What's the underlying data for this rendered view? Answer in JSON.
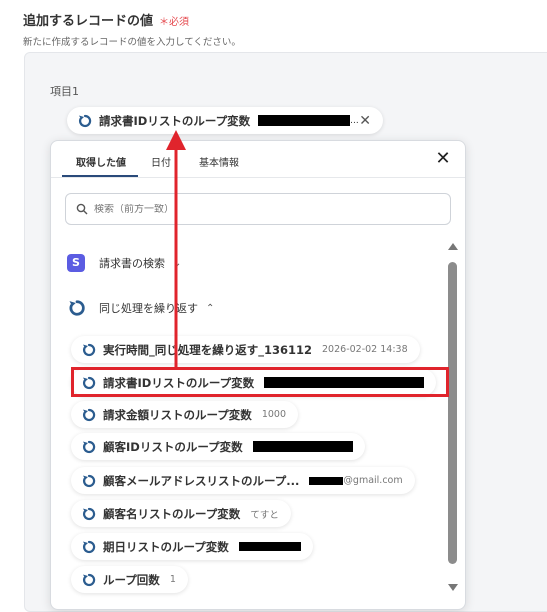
{
  "header": {
    "title": "追加するレコードの値",
    "required": "必須",
    "subtitle": "新たに作成するレコードの値を入力してください。"
  },
  "field": {
    "label": "項目1",
    "selected_chip": "請求書IDリストのループ変数",
    "selected_suffix": "..."
  },
  "dropdown": {
    "tabs": [
      "取得した値",
      "日付",
      "基本情報"
    ],
    "search_placeholder": "検索（前方一致）",
    "groups": [
      {
        "label": "請求書の検索",
        "badge": "S"
      },
      {
        "label": "同じ処理を繰り返す"
      }
    ],
    "items": [
      {
        "label": "実行時間_同じ処理を繰り返す_136112",
        "value": "2026-02-02 14:38"
      },
      {
        "label": "請求書IDリストのループ変数",
        "value": ""
      },
      {
        "label": "請求金額リストのループ変数",
        "value": "1000"
      },
      {
        "label": "顧客IDリストのループ変数",
        "value": ""
      },
      {
        "label": "顧客メールアドレスリストのループ...",
        "value": "@gmail.com"
      },
      {
        "label": "顧客名リストのループ変数",
        "value": "てすと"
      },
      {
        "label": "期日リストのループ変数",
        "value": ""
      },
      {
        "label": "ループ回数",
        "value": "1"
      }
    ]
  },
  "colors": {
    "highlight": "#e0242c",
    "loop_icon": "#2b5c8f",
    "badge": "#5b5ce2",
    "required": "#e5484d"
  },
  "icons": [
    "loop-icon",
    "close-icon",
    "search-icon",
    "chevron-down-icon",
    "chevron-up-icon",
    "s-badge-icon"
  ]
}
